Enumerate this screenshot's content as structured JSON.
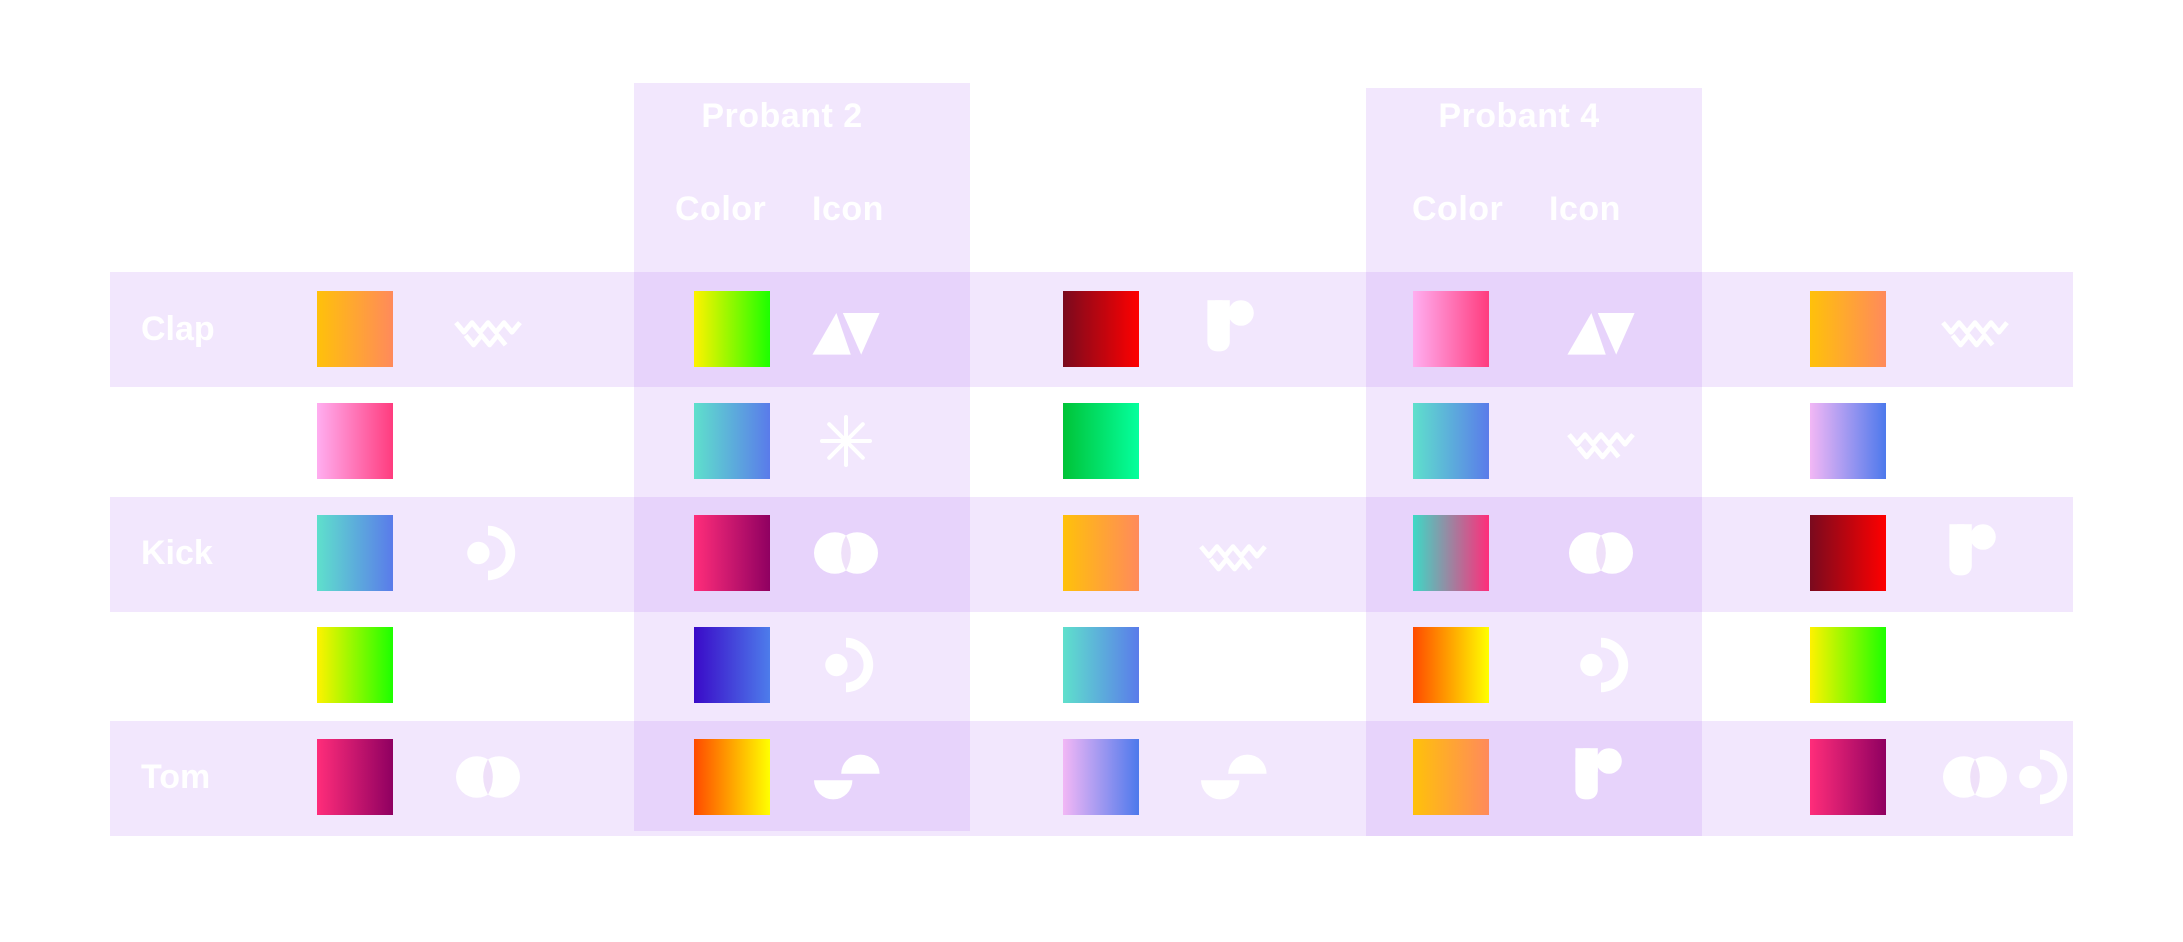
{
  "probants": [
    {
      "title": "Probant 2",
      "color_label": "Color",
      "icon_label": "Icon"
    },
    {
      "title": "Probant 4",
      "color_label": "Color",
      "icon_label": "Icon"
    }
  ],
  "rows": [
    {
      "label": "Clap"
    },
    {
      "label": ""
    },
    {
      "label": "Kick"
    },
    {
      "label": ""
    },
    {
      "label": "Tom"
    }
  ],
  "gradients": {
    "orange": [
      "#ffc10a",
      "#ff8a5b"
    ],
    "pink": [
      "#ffaef0",
      "#ff3c7e"
    ],
    "teal_blue": [
      "#5fe0cc",
      "#5a7bea"
    ],
    "yellow_green": [
      "#fff200",
      "#1dff00"
    ],
    "magenta_purple": [
      "#ff2d7a",
      "#8f0061"
    ],
    "darkred_red": [
      "#7a0a1e",
      "#ff0000"
    ],
    "green_mint": [
      "#00c337",
      "#05ff9e"
    ],
    "indigo_blue": [
      "#3a0ac8",
      "#4d7ceb"
    ],
    "orange_yellow": [
      "#ff4a00",
      "#ffff00"
    ],
    "lavender_blue": [
      "#f2b7f5",
      "#4d79ec"
    ],
    "teal_pink": [
      "#3dd9c6",
      "#ff2d7a"
    ]
  },
  "grid": [
    [
      {
        "color": "orange",
        "icon": "zigzag-icon"
      },
      {
        "color": "yellow_green",
        "icon": "triangles-icon"
      },
      {
        "color": "darkred_red",
        "icon": "p-shape-icon"
      },
      {
        "color": "pink",
        "icon": "triangles-icon"
      },
      {
        "color": "orange",
        "icon": "zigzag-icon"
      }
    ],
    [
      {
        "color": "pink",
        "icon": ""
      },
      {
        "color": "teal_blue",
        "icon": "asterisk-icon"
      },
      {
        "color": "green_mint",
        "icon": ""
      },
      {
        "color": "teal_blue",
        "icon": "zigzag-icon"
      },
      {
        "color": "lavender_blue",
        "icon": ""
      }
    ],
    [
      {
        "color": "teal_blue",
        "icon": "dot-arc-icon"
      },
      {
        "color": "magenta_purple",
        "icon": "overlap-circles-icon"
      },
      {
        "color": "orange",
        "icon": "zigzag-icon"
      },
      {
        "color": "teal_pink",
        "icon": "overlap-circles-icon"
      },
      {
        "color": "darkred_red",
        "icon": "p-shape-icon"
      }
    ],
    [
      {
        "color": "yellow_green",
        "icon": ""
      },
      {
        "color": "indigo_blue",
        "icon": "dot-arc-icon"
      },
      {
        "color": "teal_blue",
        "icon": ""
      },
      {
        "color": "orange_yellow",
        "icon": "dot-arc-icon"
      },
      {
        "color": "yellow_green",
        "icon": ""
      }
    ],
    [
      {
        "color": "magenta_purple",
        "icon": "overlap-circles-icon"
      },
      {
        "color": "orange_yellow",
        "icon": "half-circles-icon"
      },
      {
        "color": "lavender_blue",
        "icon": "half-circles-icon"
      },
      {
        "color": "orange",
        "icon": "p-shape-icon"
      },
      {
        "color": "magenta_purple",
        "icon": "overlap-circles-icon"
      },
      {
        "color": "",
        "icon": "dot-arc-icon"
      }
    ]
  ]
}
